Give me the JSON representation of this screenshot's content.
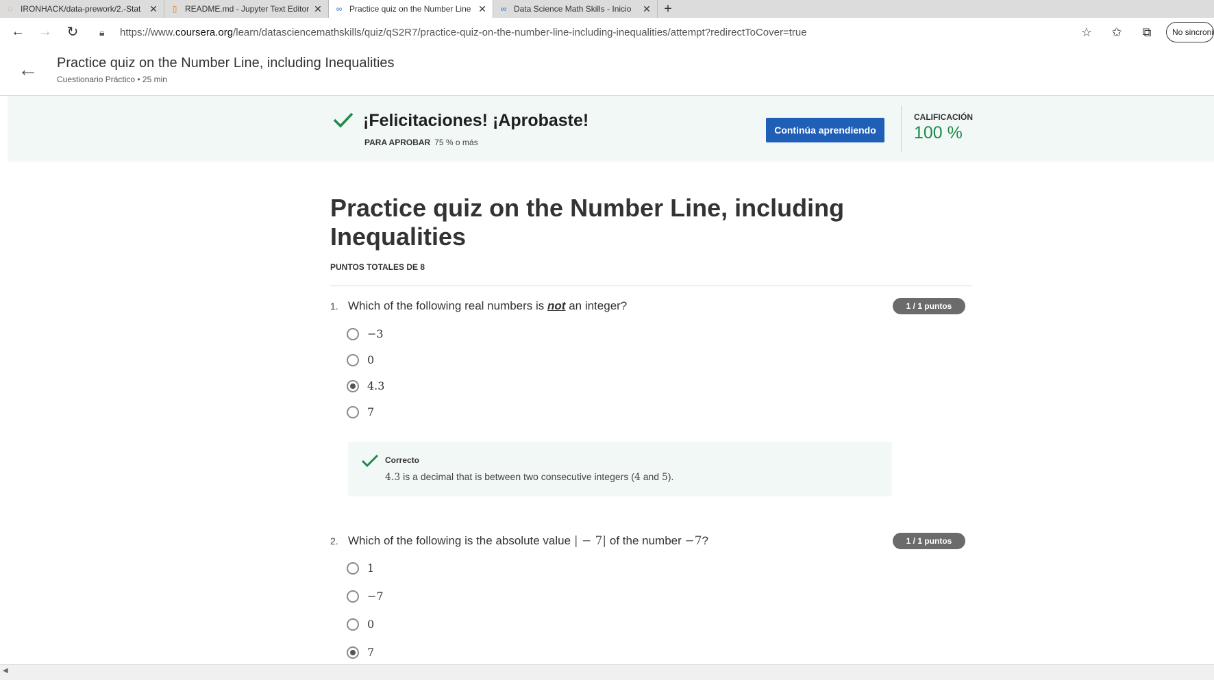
{
  "browser": {
    "tabs": [
      {
        "title": "IRONHACK/data-prework/2.-Stat",
        "icon": "circle-icon",
        "active": false
      },
      {
        "title": "README.md - Jupyter Text Editor",
        "icon": "file-icon",
        "active": false
      },
      {
        "title": "Practice quiz on the Number Line",
        "icon": "coursera-icon",
        "active": true
      },
      {
        "title": "Data Science Math Skills - Inicio",
        "icon": "coursera-icon",
        "active": false
      }
    ],
    "url_prefix": "https://www.",
    "url_domain": "coursera.org",
    "url_path": "/learn/datasciencemathskills/quiz/qS2R7/practice-quiz-on-the-number-line-including-inequalities/attempt?redirectToCover=true",
    "profile_label": "No sincronizado"
  },
  "header": {
    "title": "Practice quiz on the Number Line, including Inequalities",
    "subtitle": "Cuestionario Práctico • 25 min"
  },
  "banner": {
    "title": "¡Felicitaciones! ¡Aprobaste!",
    "pass_label": "PARA APROBAR",
    "pass_value": "75 % o más",
    "button": "Continúa aprendiendo",
    "grade_label": "CALIFICACIÓN",
    "grade_value": "100 %",
    "accent": "#1e8a4a"
  },
  "quiz": {
    "title": "Practice quiz on the Number Line, including Inequalities",
    "points_total": "PUNTOS TOTALES DE 8",
    "questions": [
      {
        "number": "1.",
        "text_before": "Which of the following real numbers is ",
        "text_emph": "not",
        "text_after": " an integer?",
        "score": "1 / 1 puntos",
        "options": [
          "−3",
          "0",
          "4.3",
          "7"
        ],
        "selected_index": 2,
        "feedback": {
          "label": "Correcto",
          "value": "4.3",
          "text": " is a decimal that is between two consecutive integers (",
          "a": "4",
          "and": " and ",
          "b": "5",
          "end": ")."
        }
      },
      {
        "number": "2.",
        "text_before": "Which of the following is the absolute value ",
        "math1": "| − 7|",
        "text_mid": " of the number ",
        "math2": "−7",
        "text_after": "?",
        "score": "1 / 1 puntos",
        "options": [
          "1",
          "−7",
          "0",
          "7"
        ],
        "selected_index": 3
      }
    ]
  }
}
